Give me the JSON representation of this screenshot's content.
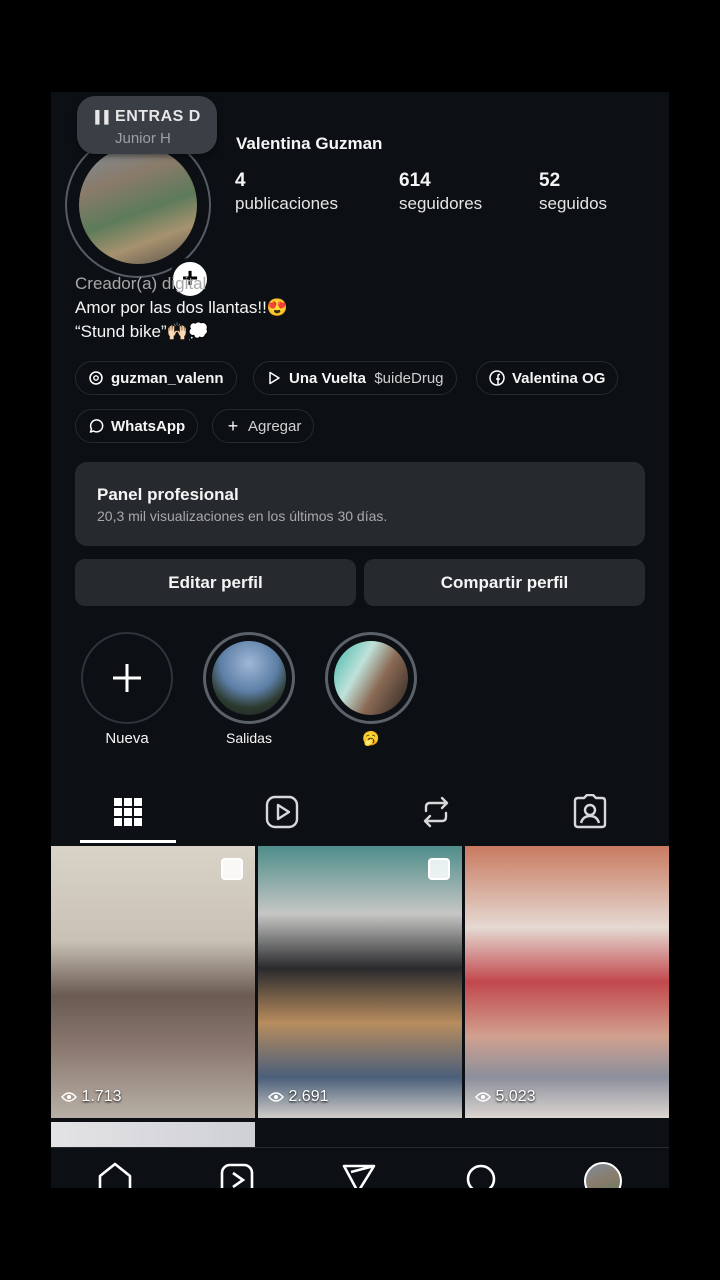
{
  "music_note": {
    "title": "ENTRAS D",
    "artist": "Junior H"
  },
  "profile": {
    "name": "Valentina Guzman",
    "stats": [
      {
        "value": "4",
        "label": "publicaciones"
      },
      {
        "value": "614",
        "label": "seguidores"
      },
      {
        "value": "52",
        "label": "seguidos"
      }
    ],
    "category": "Creador(a) digital",
    "bio_line1": "Amor por las dos llantas!!😍",
    "bio_line2": "“Stund bike”🙌🏻💭"
  },
  "links": {
    "threads": "guzman_valenn",
    "music_song": "Una Vuelta",
    "music_artist": "$uideDrug",
    "facebook": "Valentina OG",
    "whatsapp": "WhatsApp",
    "add": "Agregar"
  },
  "panel": {
    "title": "Panel profesional",
    "subtitle": "20,3 mil visualizaciones en los últimos 30 días."
  },
  "buttons": {
    "edit": "Editar perfil",
    "share": "Compartir perfil"
  },
  "highlights": [
    {
      "label": "Nueva"
    },
    {
      "label": "Salidas"
    },
    {
      "label": "🥱"
    }
  ],
  "posts": [
    {
      "views": "1.713"
    },
    {
      "views": "2.691"
    },
    {
      "views": "5.023"
    }
  ],
  "icons": [
    "music-bars-icon",
    "plus-icon",
    "threads-icon",
    "play-icon",
    "facebook-icon",
    "whatsapp-icon",
    "grid-icon",
    "reels-icon",
    "repost-icon",
    "tagged-icon",
    "home-icon",
    "send-icon",
    "search-icon",
    "eye-icon"
  ]
}
